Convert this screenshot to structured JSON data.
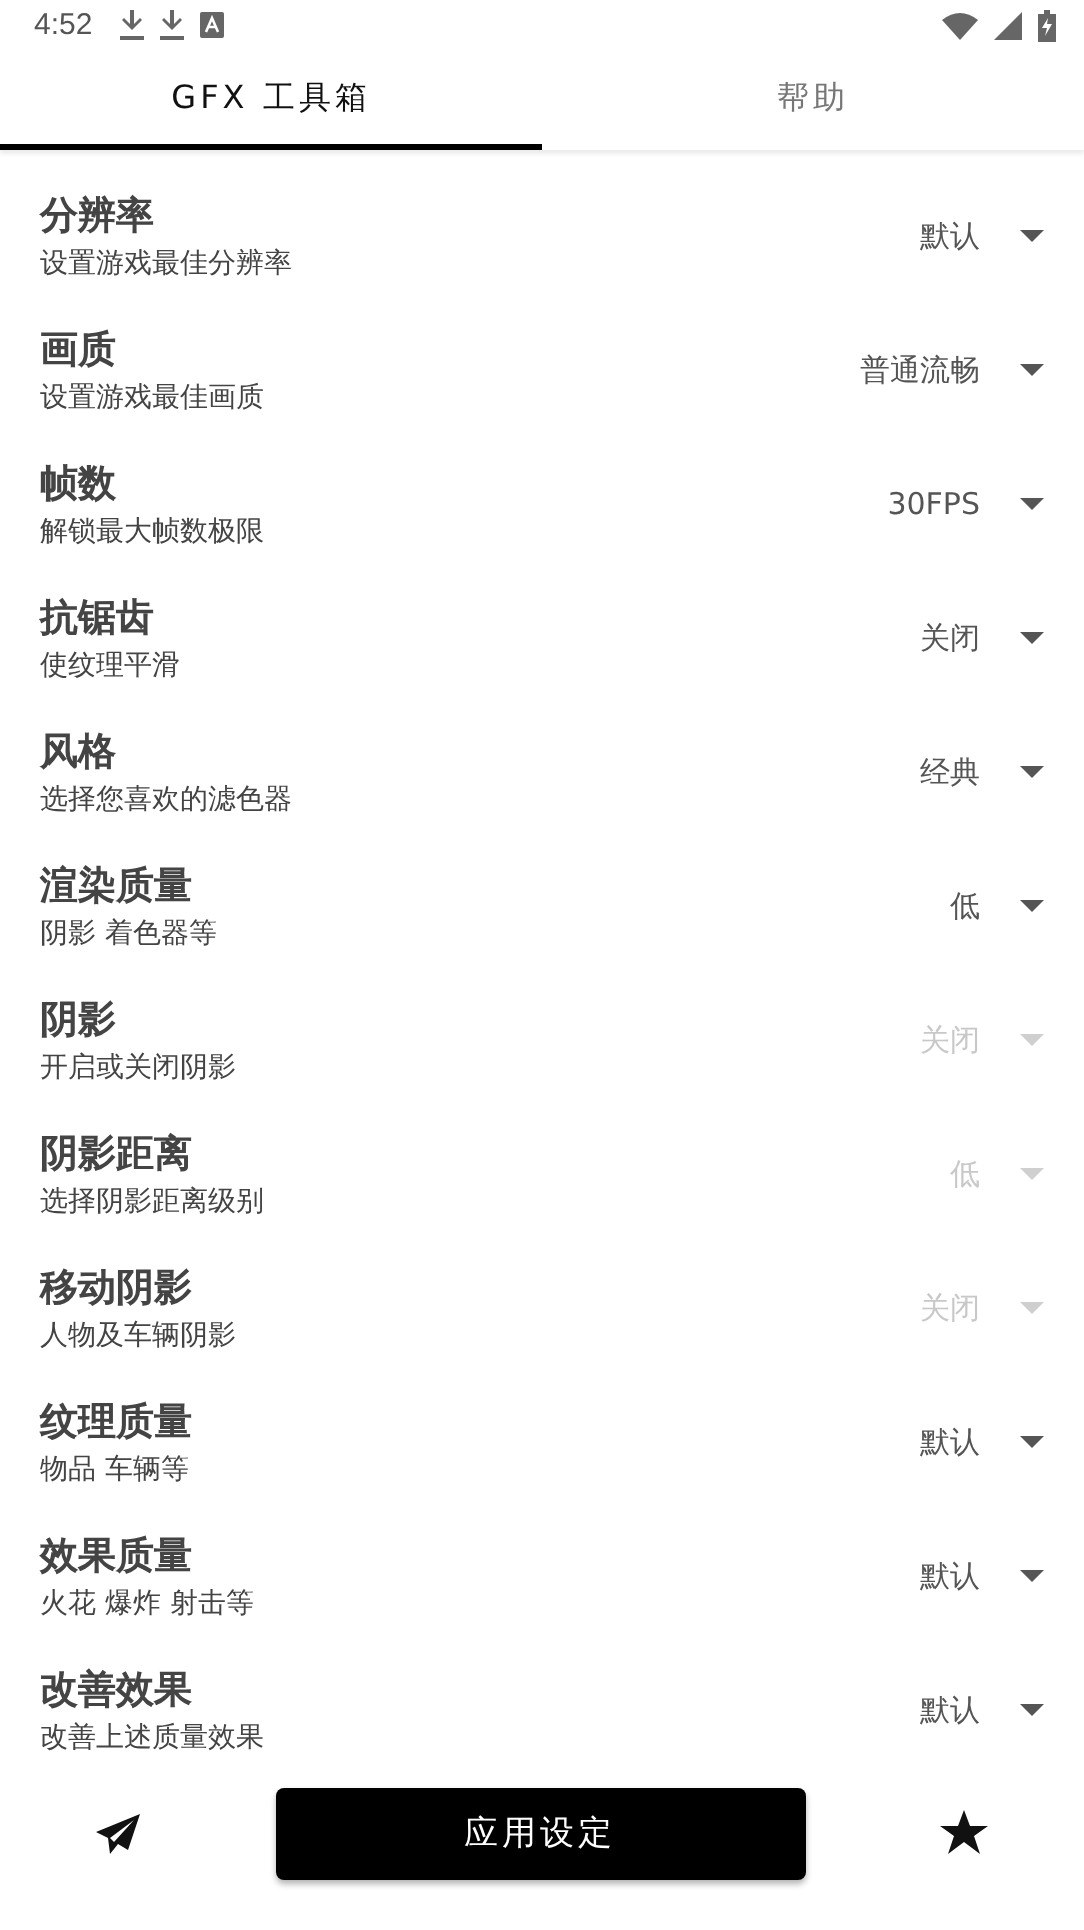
{
  "status_bar": {
    "time": "4:52"
  },
  "tabs": [
    {
      "label": "GFX 工具箱",
      "selected": true
    },
    {
      "label": "帮助",
      "selected": false
    }
  ],
  "settings": [
    {
      "title": "分辨率",
      "subtitle": "设置游戏最佳分辨率",
      "value": "默认",
      "disabled": false
    },
    {
      "title": "画质",
      "subtitle": "设置游戏最佳画质",
      "value": "普通流畅",
      "disabled": false
    },
    {
      "title": "帧数",
      "subtitle": "解锁最大帧数极限",
      "value": "30FPS",
      "disabled": false
    },
    {
      "title": "抗锯齿",
      "subtitle": "使纹理平滑",
      "value": "关闭",
      "disabled": false
    },
    {
      "title": "风格",
      "subtitle": "选择您喜欢的滤色器",
      "value": "经典",
      "disabled": false
    },
    {
      "title": "渲染质量",
      "subtitle": "阴影 着色器等",
      "value": "低",
      "disabled": false
    },
    {
      "title": "阴影",
      "subtitle": "开启或关闭阴影",
      "value": "关闭",
      "disabled": true
    },
    {
      "title": "阴影距离",
      "subtitle": "选择阴影距离级别",
      "value": "低",
      "disabled": true
    },
    {
      "title": "移动阴影",
      "subtitle": "人物及车辆阴影",
      "value": "关闭",
      "disabled": true
    },
    {
      "title": "纹理质量",
      "subtitle": "物品 车辆等",
      "value": "默认",
      "disabled": false
    },
    {
      "title": "效果质量",
      "subtitle": "火花 爆炸 射击等",
      "value": "默认",
      "disabled": false
    },
    {
      "title": "改善效果",
      "subtitle": "改善上述质量效果",
      "value": "默认",
      "disabled": false
    }
  ],
  "apply_button": "应用设定"
}
